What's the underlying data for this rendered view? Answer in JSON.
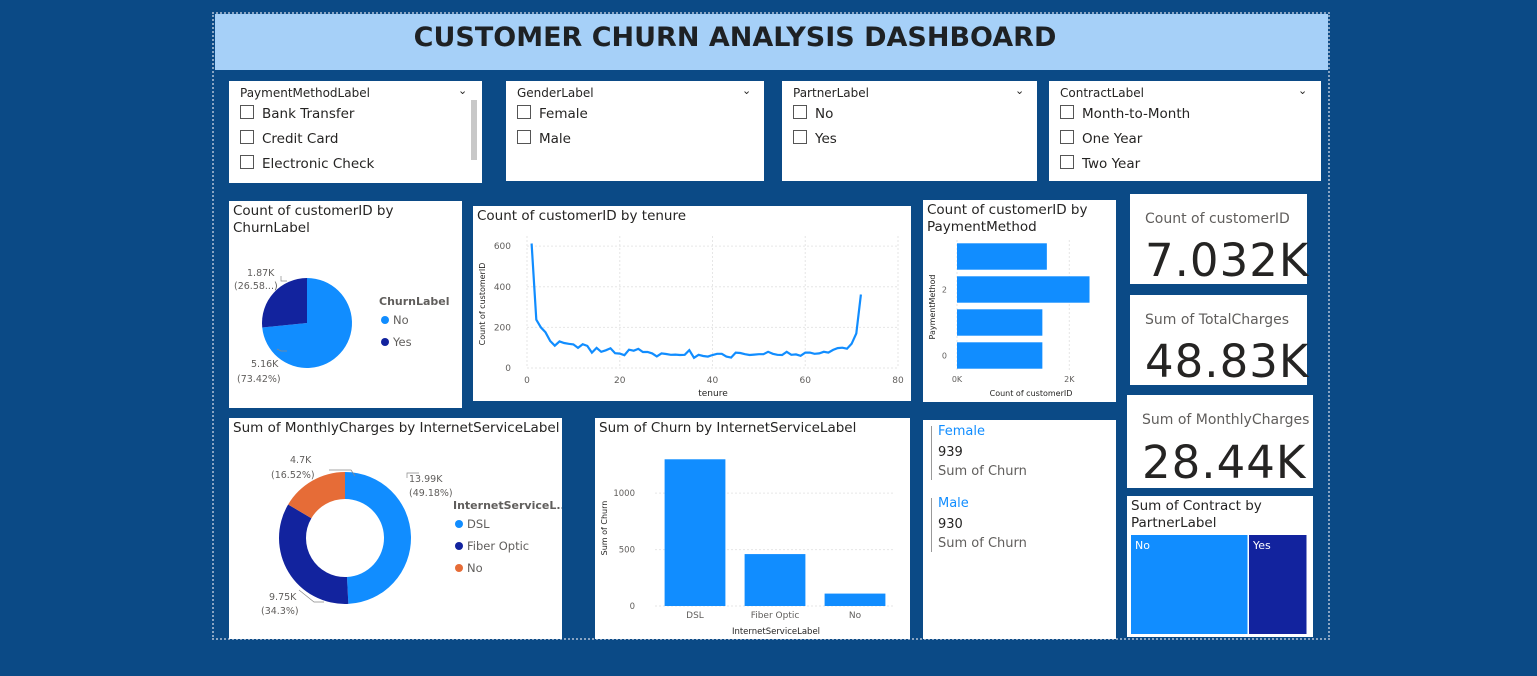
{
  "header": {
    "title": "CUSTOMER CHURN ANALYSIS DASHBOARD"
  },
  "slicers": [
    {
      "label": "PaymentMethodLabel",
      "items": [
        "Bank Transfer",
        "Credit Card",
        "Electronic Check"
      ]
    },
    {
      "label": "GenderLabel",
      "items": [
        "Female",
        "Male"
      ]
    },
    {
      "label": "PartnerLabel",
      "items": [
        "No",
        "Yes"
      ]
    },
    {
      "label": "ContractLabel",
      "items": [
        "Month-to-Month",
        "One Year",
        "Two Year"
      ]
    }
  ],
  "kpis": [
    {
      "label": "Count of customerID",
      "value": "7.032K"
    },
    {
      "label": "Sum of TotalCharges",
      "value": "48.83K"
    },
    {
      "label": "Sum of MonthlyCharges",
      "value": "28.44K"
    }
  ],
  "multirow": [
    {
      "name": "Female",
      "value": "939",
      "measure": "Sum of Churn"
    },
    {
      "name": "Male",
      "value": "930",
      "measure": "Sum of Churn"
    }
  ],
  "colors": {
    "blue": "#118dff",
    "navy": "#12239e",
    "orange": "#e66c37",
    "background": "#0b4a86",
    "title_band": "#a6d0f8"
  },
  "chart_data": [
    {
      "type": "pie",
      "title": "Count of customerID by ChurnLabel",
      "legend_title": "ChurnLabel",
      "legend_position": "right",
      "slices": [
        {
          "label": "No",
          "value": 5160,
          "display": "5.16K",
          "pct": "(73.42%)",
          "color": "#118dff"
        },
        {
          "label": "Yes",
          "value": 1870,
          "display": "1.87K",
          "pct": "(26.58...)",
          "color": "#12239e"
        }
      ]
    },
    {
      "type": "line",
      "title": "Count of customerID by tenure",
      "xlabel": "tenure",
      "ylabel": "Count of customerID",
      "xlim": [
        0,
        80
      ],
      "ylim": [
        0,
        650
      ],
      "xticks": [
        "0",
        "20",
        "40",
        "60",
        "80"
      ],
      "yticks": [
        "0",
        "200",
        "400",
        "600"
      ],
      "grid": true,
      "x": [
        1,
        2,
        3,
        4,
        5,
        6,
        7,
        8,
        9,
        10,
        11,
        12,
        13,
        14,
        15,
        16,
        17,
        18,
        19,
        20,
        21,
        22,
        23,
        24,
        25,
        26,
        27,
        28,
        29,
        30,
        31,
        32,
        33,
        34,
        35,
        36,
        37,
        38,
        39,
        40,
        41,
        42,
        43,
        44,
        45,
        46,
        47,
        48,
        49,
        50,
        51,
        52,
        53,
        54,
        55,
        56,
        57,
        58,
        59,
        60,
        61,
        62,
        63,
        64,
        65,
        66,
        67,
        68,
        69,
        70,
        71,
        72
      ],
      "y": [
        613,
        238,
        200,
        176,
        133,
        110,
        131,
        123,
        119,
        116,
        99,
        117,
        109,
        76,
        99,
        80,
        87,
        97,
        73,
        71,
        63,
        90,
        85,
        94,
        79,
        79,
        72,
        57,
        72,
        69,
        65,
        66,
        64,
        65,
        88,
        50,
        65,
        59,
        56,
        64,
        70,
        70,
        56,
        51,
        76,
        74,
        68,
        64,
        66,
        68,
        68,
        80,
        70,
        65,
        64,
        80,
        65,
        67,
        60,
        76,
        76,
        70,
        72,
        80,
        76,
        89,
        98,
        100,
        95,
        119,
        170,
        362
      ]
    },
    {
      "type": "bar",
      "orientation": "horizontal",
      "title": "Count of customerID by PaymentMethod",
      "xlabel": "Count of customerID",
      "ylabel": "PaymentMethod",
      "categories": [
        "0",
        "1",
        "2",
        "3"
      ],
      "values": [
        1520,
        1520,
        2360,
        1600
      ],
      "xlim": [
        0,
        2600
      ],
      "xticks": [
        "0K",
        "2K"
      ],
      "yticks": [
        "0",
        "2"
      ],
      "grid": true
    },
    {
      "type": "pie",
      "donut": true,
      "title": "Sum of MonthlyCharges by InternetServiceLabel",
      "legend_title": "InternetServiceL...",
      "legend_position": "right",
      "slices": [
        {
          "label": "DSL",
          "value": 13990,
          "display": "13.99K",
          "pct": "(49.18%)",
          "color": "#118dff"
        },
        {
          "label": "Fiber Optic",
          "value": 9750,
          "display": "9.75K",
          "pct": "(34.3%)",
          "color": "#12239e"
        },
        {
          "label": "No",
          "value": 4700,
          "display": "4.7K",
          "pct": "(16.52%)",
          "color": "#e66c37"
        }
      ]
    },
    {
      "type": "bar",
      "title": "Sum of Churn by InternetServiceLabel",
      "xlabel": "InternetServiceLabel",
      "ylabel": "Sum of Churn",
      "categories": [
        "DSL",
        "Fiber Optic",
        "No"
      ],
      "values": [
        1300,
        460,
        110
      ],
      "ylim": [
        0,
        1400
      ],
      "yticks": [
        "0",
        "500",
        "1000"
      ],
      "grid": true
    },
    {
      "type": "treemap",
      "title": "Sum of Contract by PartnerLabel",
      "categories": [
        "No",
        "Yes"
      ],
      "values": [
        60,
        30
      ],
      "colors": [
        "#118dff",
        "#12239e"
      ]
    }
  ]
}
